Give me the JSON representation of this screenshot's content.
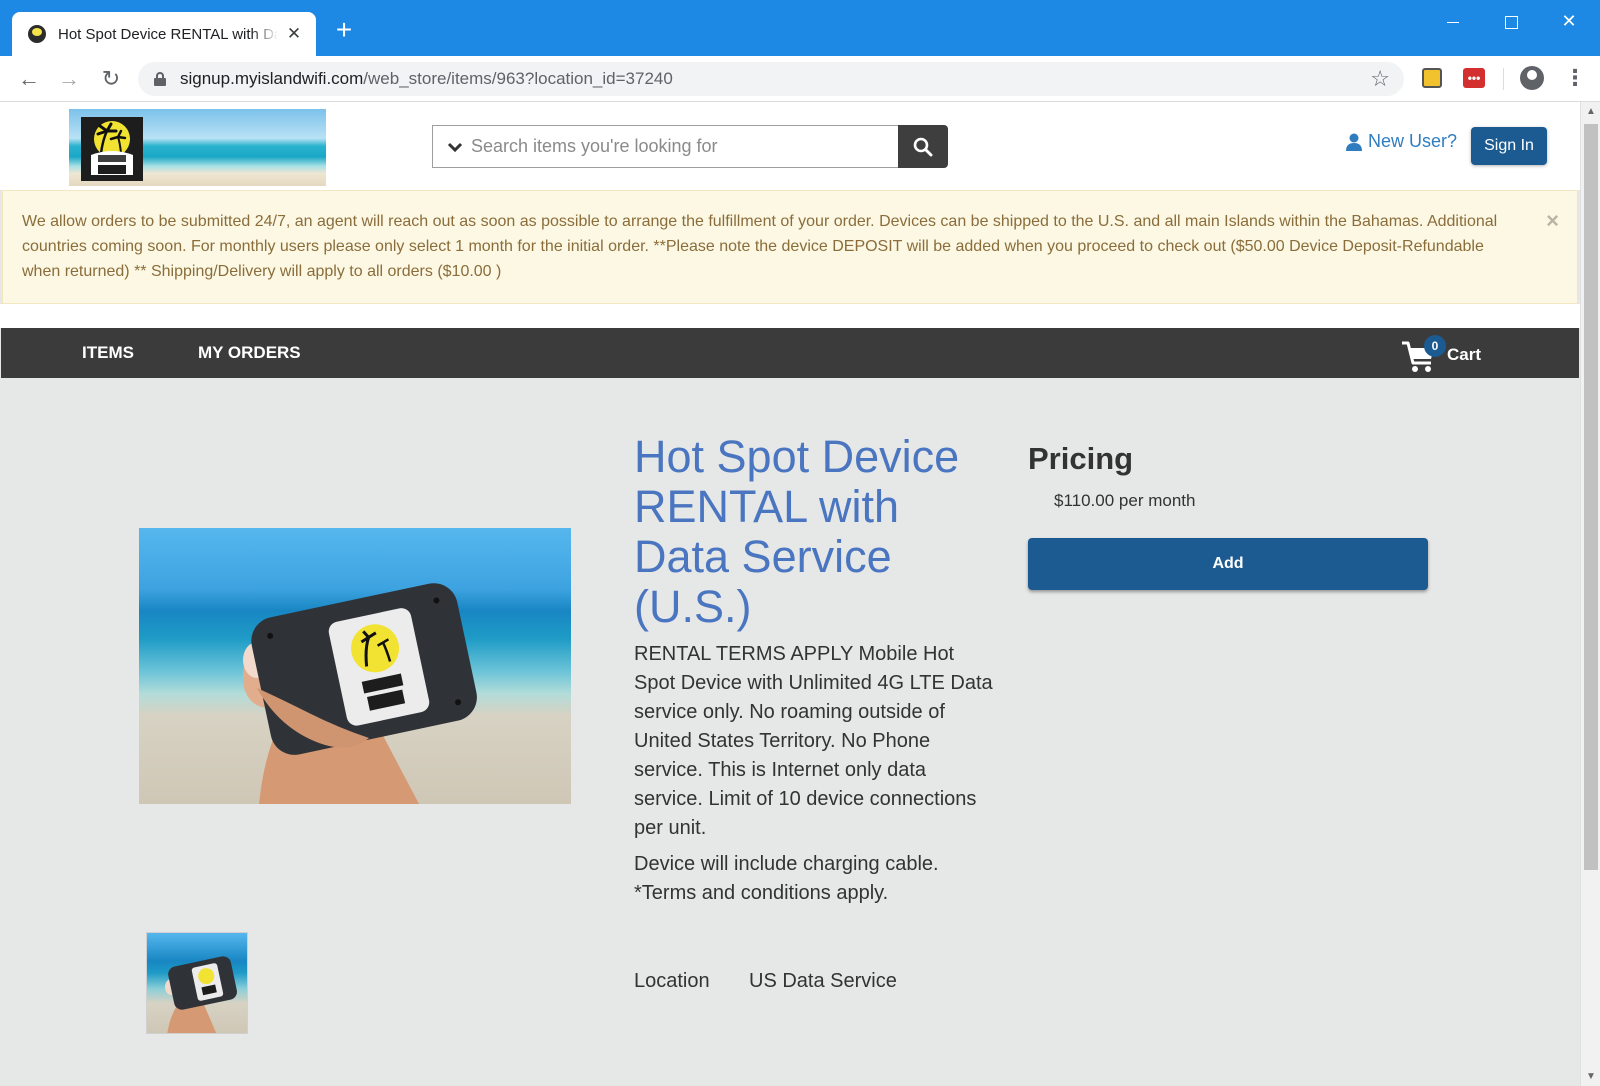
{
  "browser": {
    "tab_title": "Hot Spot Device RENTAL with Data Service (U.S.)",
    "url_host": "signup.myislandwifi.com",
    "url_path": "/web_store/items/963?location_id=37240"
  },
  "header": {
    "search_placeholder": "Search items you're looking for",
    "new_user_label": "New User?",
    "sign_in_label": "Sign In"
  },
  "alert": {
    "text": "We allow orders to be submitted 24/7, an agent will reach out as soon as possible to arrange the fulfillment of your order. Devices can be shipped to the U.S. and all main Islands within the Bahamas. Additional countries coming soon. For monthly users please only select 1 month for the initial order. **Please note the device DEPOSIT will be added when you proceed to check out ($50.00 Device Deposit-Refundable when returned) ** Shipping/Delivery will apply to all orders ($10.00 )",
    "close_label": "×"
  },
  "nav": {
    "items_label": "ITEMS",
    "orders_label": "MY ORDERS",
    "cart_count": "0",
    "cart_label": "Cart"
  },
  "product": {
    "title": "Hot Spot Device RENTAL with Data Service (U.S.)",
    "description": "RENTAL TERMS APPLY Mobile Hot Spot Device with Unlimited 4G LTE Data service only. No roaming outside of United States Territory. No Phone service. This is Internet only data service. Limit of 10 device connections per unit.",
    "description2": "Device will include charging cable. *Terms and conditions apply.",
    "location_label": "Location",
    "location_value": "US Data Service"
  },
  "pricing": {
    "title": "Pricing",
    "price": "$110.00 per month",
    "add_label": "Add"
  },
  "colors": {
    "browser_blue": "#1e88e5",
    "brand_blue": "#1c5a92",
    "title_blue": "#4a75c0",
    "navbar": "#3b3b3b",
    "alert_bg": "#fcf8e3",
    "alert_text": "#8a6d3b"
  },
  "icons": [
    "chevron-down-icon",
    "search-icon",
    "user-icon",
    "cart-icon",
    "lock-icon",
    "star-icon",
    "close-icon"
  ]
}
